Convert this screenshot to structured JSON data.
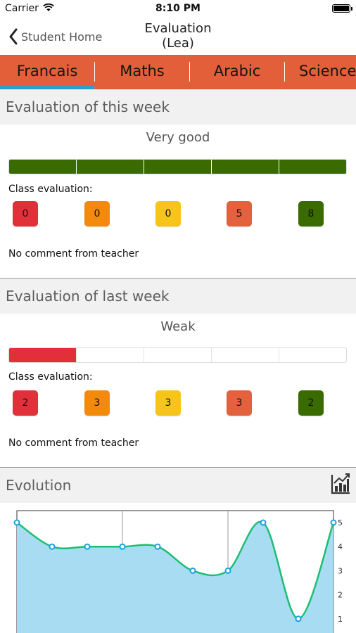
{
  "status_bar": {
    "carrier": "Carrier",
    "time": "8:10 PM"
  },
  "nav": {
    "back_label": "Student Home",
    "title_line1": "Evaluation",
    "title_line2": "(Lea)"
  },
  "tabs": [
    "Francais",
    "Maths",
    "Arabic",
    "Science"
  ],
  "colors": {
    "tab_bar": "#e35f39",
    "tab_indicator": "#2a9fd6",
    "very_bad": "#e2303b",
    "bad": "#f38a0c",
    "average": "#f7c41a",
    "weak": "#e3623d",
    "very_good": "#3a6b00",
    "chart_fill": "#a7dcf3",
    "chart_line": "#1dbe72",
    "chart_point": "#1aa0e0"
  },
  "this_week": {
    "title": "Evaluation of this week",
    "rating": "Very good",
    "level": 5,
    "level_max": 5,
    "class_label": "Class evaluation:",
    "counts": [
      "0",
      "0",
      "0",
      "5",
      "8"
    ],
    "comment": "No comment from teacher"
  },
  "last_week": {
    "title": "Evaluation of last week",
    "rating": "Weak",
    "level": 1,
    "level_max": 5,
    "class_label": "Class evaluation:",
    "counts": [
      "2",
      "3",
      "3",
      "3",
      "2"
    ],
    "comment": "No comment from teacher"
  },
  "evolution": {
    "title": "Evolution",
    "icon": "line-chart-icon"
  },
  "chart_data": {
    "type": "line",
    "x": [
      1,
      2,
      3,
      4,
      5,
      6,
      7,
      8,
      9,
      10
    ],
    "values": [
      5,
      4,
      4,
      4,
      4,
      3,
      3,
      5,
      1,
      5
    ],
    "yticks": [
      "5",
      "4",
      "3",
      "2",
      "1"
    ],
    "ylim": [
      0,
      5
    ],
    "grid": true
  }
}
